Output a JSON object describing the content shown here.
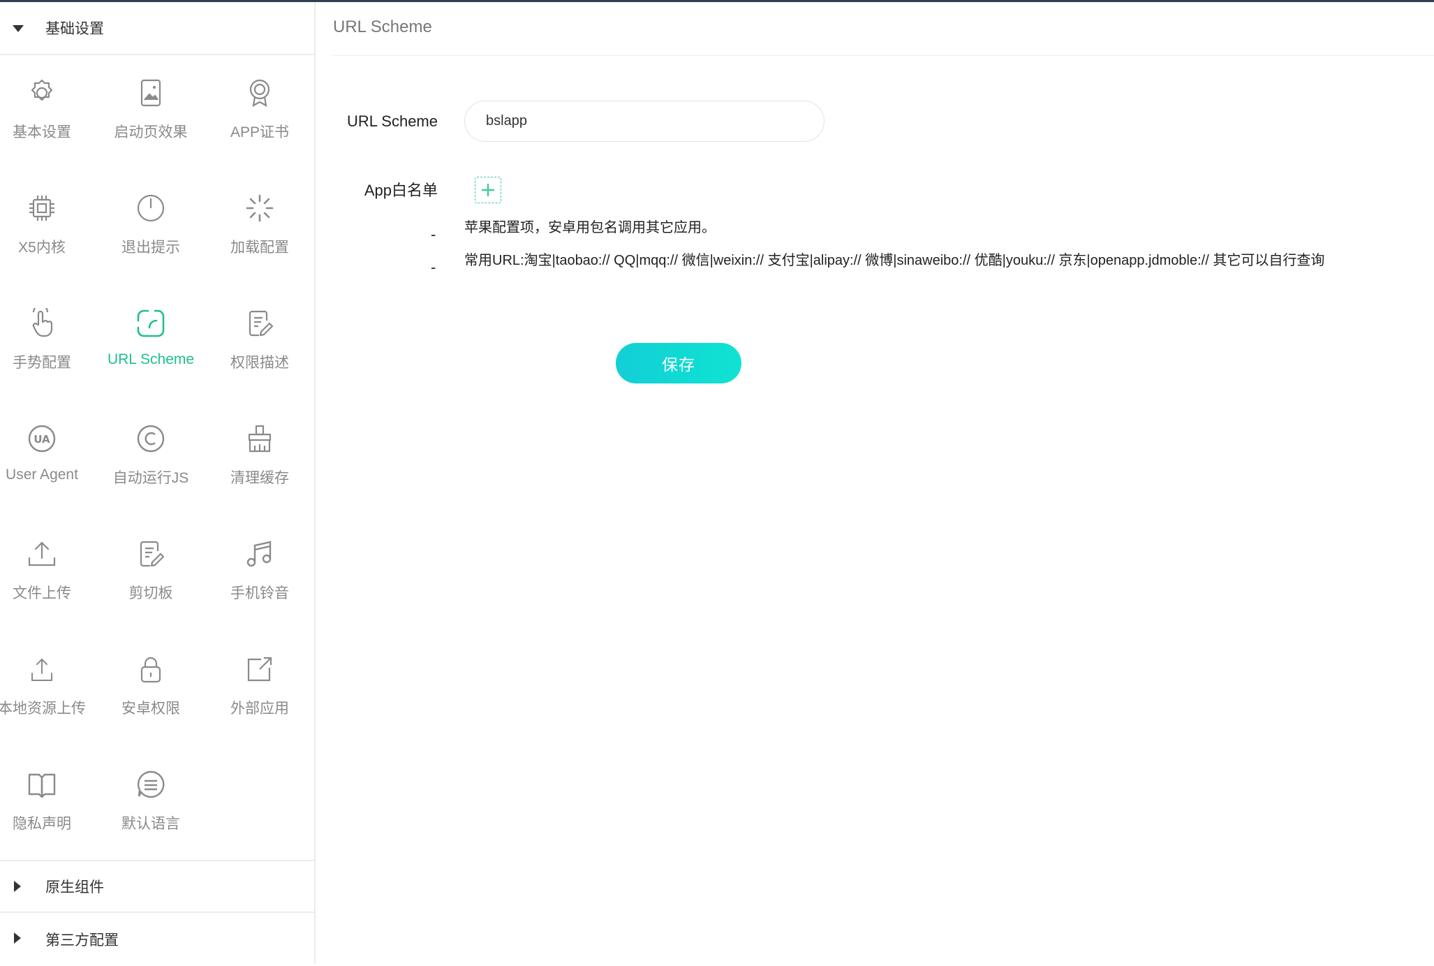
{
  "sidebar": {
    "sections": {
      "basic": {
        "label": "基础设置",
        "expanded": true
      },
      "native": {
        "label": "原生组件",
        "expanded": false
      },
      "third": {
        "label": "第三方配置",
        "expanded": false
      }
    },
    "items": [
      {
        "label": "基本设置",
        "icon": "gear-icon"
      },
      {
        "label": "启动页效果",
        "icon": "splash-image-icon"
      },
      {
        "label": "APP证书",
        "icon": "certificate-icon"
      },
      {
        "label": "X5内核",
        "icon": "chip-icon"
      },
      {
        "label": "退出提示",
        "icon": "power-icon"
      },
      {
        "label": "加载配置",
        "icon": "loading-spinner-icon"
      },
      {
        "label": "手势配置",
        "icon": "hand-pointer-icon"
      },
      {
        "label": "URL Scheme",
        "icon": "url-scheme-icon",
        "active": true
      },
      {
        "label": "权限描述",
        "icon": "document-edit-icon"
      },
      {
        "label": "User Agent",
        "icon": "user-agent-icon"
      },
      {
        "label": "自动运行JS",
        "icon": "copyright-icon"
      },
      {
        "label": "清理缓存",
        "icon": "broom-icon"
      },
      {
        "label": "文件上传",
        "icon": "upload-icon"
      },
      {
        "label": "剪切板",
        "icon": "clipboard-edit-icon"
      },
      {
        "label": "手机铃音",
        "icon": "music-note-icon"
      },
      {
        "label": "本地资源上传",
        "icon": "local-upload-icon"
      },
      {
        "label": "安卓权限",
        "icon": "lock-icon"
      },
      {
        "label": "外部应用",
        "icon": "external-link-icon"
      },
      {
        "label": "隐私声明",
        "icon": "book-icon"
      },
      {
        "label": "默认语言",
        "icon": "language-chat-icon"
      }
    ]
  },
  "main": {
    "title": "URL Scheme",
    "form": {
      "scheme_label": "URL Scheme",
      "scheme_value": "bslapp",
      "whitelist_label": "App白名单",
      "dash": "-",
      "note1": "苹果配置项，安卓用包名调用其它应用。",
      "note2": "常用URL:淘宝|taobao:// QQ|mqq:// 微信|weixin:// 支付宝|alipay:// 微博|sinaweibo:// 优酷|youku:// 京东|openapp.jdmoble:// 其它可以自行查询",
      "save_label": "保存"
    }
  },
  "colors": {
    "accent": "#1fbf8f",
    "save_button": "#12cfd6",
    "icon_gray": "#8a8a8a"
  }
}
